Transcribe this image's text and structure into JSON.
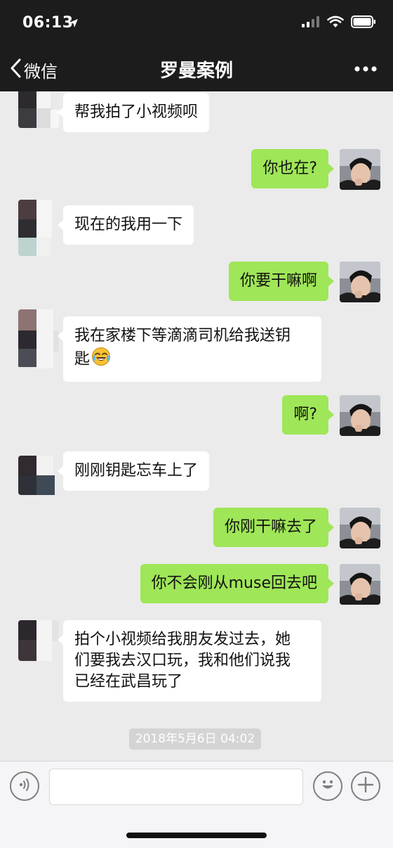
{
  "status_bar": {
    "time": "06:13"
  },
  "nav": {
    "back_label": "微信",
    "title": "罗曼案例"
  },
  "messages": [
    {
      "text": "帮我拍了小视频呗"
    },
    {
      "text": "你也在?"
    },
    {
      "text": "现在的我用一下"
    },
    {
      "text": "你要干嘛啊"
    },
    {
      "line1": "我在家楼下等滴滴司机给我送钥",
      "line2": "匙"
    },
    {
      "text": "啊?"
    },
    {
      "text": "刚刚钥匙忘车上了"
    },
    {
      "text": "你刚干嘛去了"
    },
    {
      "text": "你不会刚从muse回去吧"
    },
    {
      "line1": "拍个小视频给我朋友发过去，她",
      "line2": "们要我去汉口玩，我和他们说我",
      "line3": "已经在武昌玩了"
    }
  ],
  "timestamp": "2018年5月6日 04:02",
  "input": {
    "value": "",
    "placeholder": ""
  },
  "colors": {
    "header_bg": "#1c1c1c",
    "chat_bg": "#ebebeb",
    "sent_bubble": "#9fe658",
    "received_bubble": "#ffffff"
  },
  "icons": [
    "location-arrow-icon",
    "signal-icon",
    "wifi-icon",
    "battery-icon",
    "back-chevron-icon",
    "more-dots-icon",
    "voice-icon",
    "emoji-icon",
    "plus-icon",
    "crying-laughing-emoji-icon"
  ]
}
